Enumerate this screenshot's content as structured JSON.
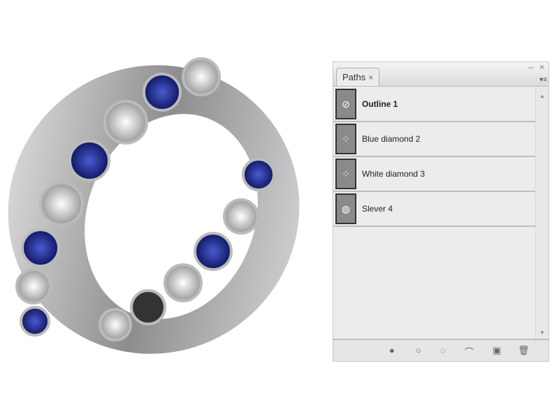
{
  "panel": {
    "tab_label": "Paths",
    "tab_close": "×",
    "minimize": "–",
    "close": "×",
    "menu": "▾≡",
    "paths": [
      {
        "label": "Outline 1",
        "selected": true,
        "icon": "outline-path-icon",
        "glyph": "⊘"
      },
      {
        "label": "Blue diamond 2",
        "selected": false,
        "icon": "dotted-path-icon",
        "glyph": "⁘"
      },
      {
        "label": "White diamond 3",
        "selected": false,
        "icon": "dotted-path-icon",
        "glyph": "⁘"
      },
      {
        "label": "Slever  4",
        "selected": false,
        "icon": "ring-path-icon",
        "glyph": "◍"
      }
    ],
    "footer": [
      {
        "name": "fill-path-button",
        "glyph": "●"
      },
      {
        "name": "stroke-path-button",
        "glyph": "○"
      },
      {
        "name": "load-selection-button",
        "glyph": "◌"
      },
      {
        "name": "make-work-path-button",
        "glyph": "⌒"
      },
      {
        "name": "new-path-button",
        "glyph": "▣"
      },
      {
        "name": "delete-path-button",
        "glyph": "🗑"
      }
    ]
  }
}
